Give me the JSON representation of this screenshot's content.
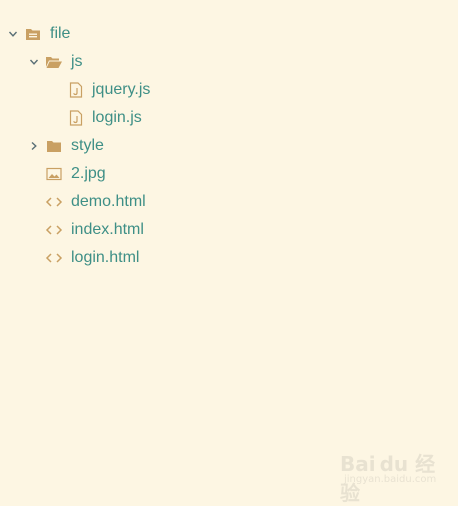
{
  "tree": {
    "root": {
      "label": "file",
      "icon": "folder-icon",
      "expanded": true
    },
    "js": {
      "label": "js",
      "icon": "folder-open-icon",
      "expanded": true
    },
    "jquery": {
      "label": "jquery.js",
      "icon": "js-file-icon"
    },
    "loginjs": {
      "label": "login.js",
      "icon": "js-file-icon"
    },
    "style": {
      "label": "style",
      "icon": "folder-icon",
      "expanded": false
    },
    "img": {
      "label": "2.jpg",
      "icon": "image-file-icon"
    },
    "demo": {
      "label": "demo.html",
      "icon": "code-icon"
    },
    "index": {
      "label": "index.html",
      "icon": "code-icon"
    },
    "loginhtml": {
      "label": "login.html",
      "icon": "code-icon"
    }
  },
  "watermark": {
    "logo": "Bai du 经验",
    "url": "jingyan.baidu.com"
  },
  "colors": {
    "background": "#fdf6e3",
    "text": "#3e8f86",
    "icon": "#c9a063",
    "arrow": "#586e75"
  }
}
